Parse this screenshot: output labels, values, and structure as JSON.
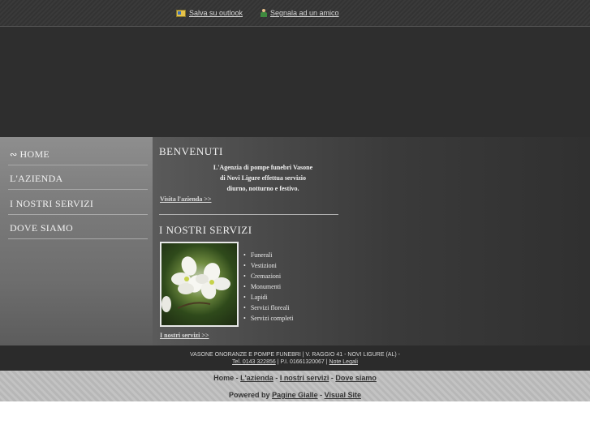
{
  "topbar": {
    "outlook_label": "Salva su outlook",
    "friend_label": "Segnala ad un amico"
  },
  "nav": {
    "items": [
      {
        "label": "HOME",
        "icon": "home-icon"
      },
      {
        "label": "L'AZIENDA"
      },
      {
        "label": "I NOSTRI SERVIZI"
      },
      {
        "label": "DOVE SIAMO"
      }
    ]
  },
  "welcome": {
    "title": "BENVENUTI",
    "text_l1": "L'Agenzia di pompe funebri Vasone",
    "text_l2": "di Novi Ligure effettua servizio",
    "text_l3": "diurno, notturno e festivo.",
    "link": "Visita l'azienda >>"
  },
  "services": {
    "title": "I NOSTRI SERVIZI",
    "items": [
      "Funerali",
      "Vestizioni",
      "Cremazioni",
      "Monumenti",
      "Lapidi",
      "Servizi floreali",
      "Servizi completi"
    ],
    "link": "I nostri servizi >>"
  },
  "footer": {
    "line1": "VASONE ONORANZE E POMPE FUNEBRI | V. RAGGIO 41 - NOVI LIGURE (AL) -",
    "tel": "Tel. 0143 322856",
    "piva": " | P.I. 01661320067 | ",
    "legal": "Note Legali"
  },
  "bottom": {
    "home": "Home",
    "azienda": "L'azienda",
    "servizi": "I nostri servizi",
    "dove": "Dove siamo",
    "powered_label": "Powered by",
    "pagine": "Pagine Gialle",
    "visual": "Visual Site"
  }
}
